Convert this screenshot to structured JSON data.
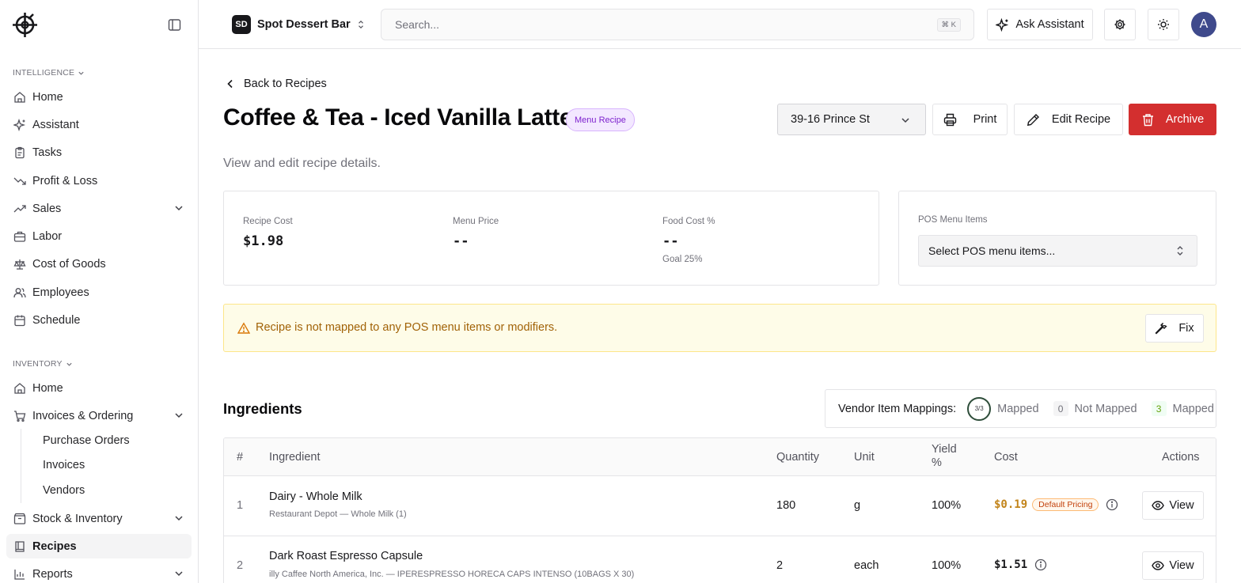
{
  "sidebar": {
    "intelligence_label": "INTELLIGENCE",
    "intelligence_items": [
      {
        "label": "Home",
        "icon": "house-icon"
      },
      {
        "label": "Assistant",
        "icon": "sparkles-icon"
      },
      {
        "label": "Tasks",
        "icon": "clipboard-icon"
      },
      {
        "label": "Profit & Loss",
        "icon": "trending-down-icon"
      },
      {
        "label": "Sales",
        "icon": "trending-up-icon"
      },
      {
        "label": "Labor",
        "icon": "briefcase-icon"
      },
      {
        "label": "Cost of Goods",
        "icon": "scale-icon"
      },
      {
        "label": "Employees",
        "icon": "users-icon"
      },
      {
        "label": "Schedule",
        "icon": "calendar-icon"
      }
    ],
    "inventory_label": "INVENTORY",
    "inventory_items": [
      {
        "label": "Home",
        "icon": "house-icon"
      },
      {
        "label": "Invoices & Ordering",
        "icon": "cart-icon"
      },
      {
        "label": "Stock & Inventory",
        "icon": "box-icon"
      },
      {
        "label": "Recipes",
        "icon": "book-icon",
        "active": true
      },
      {
        "label": "Reports",
        "icon": "chart-icon"
      }
    ],
    "invoice_subitems": [
      "Purchase Orders",
      "Invoices",
      "Vendors"
    ]
  },
  "topbar": {
    "org_initials": "SD",
    "org_name": "Spot Dessert Bar",
    "search_placeholder": "Search...",
    "search_shortcut": "⌘ K",
    "ask_label": "Ask Assistant",
    "avatar_initial": "A"
  },
  "page": {
    "back_label": "Back to Recipes",
    "title": "Coffee & Tea - Iced Vanilla Latte",
    "badge": "Menu Recipe",
    "location": "39-16 Prince St",
    "print_label": "Print",
    "edit_label": "Edit Recipe",
    "archive_label": "Archive",
    "subtitle": "View and edit recipe details."
  },
  "metrics": {
    "recipe_cost_label": "Recipe Cost",
    "recipe_cost": "$1.98",
    "menu_price_label": "Menu Price",
    "menu_price": "--",
    "food_cost_label": "Food Cost %",
    "food_cost": "--",
    "goal": "Goal 25%"
  },
  "pos": {
    "label": "POS Menu Items",
    "placeholder": "Select POS menu items..."
  },
  "alert": {
    "text": "Recipe is not mapped to any POS menu items or modifiers.",
    "fix_label": "Fix"
  },
  "ingredients": {
    "title": "Ingredients",
    "mapping_label": "Vendor Item Mappings:",
    "ring_text": "3/3",
    "mapped_label": "Mapped",
    "not_mapped_count": "0",
    "not_mapped_label": "Not Mapped",
    "mapped_count": "3",
    "mapped_label_2": "Mapped",
    "columns": {
      "num": "#",
      "ingredient": "Ingredient",
      "quantity": "Quantity",
      "unit": "Unit",
      "yield": "Yield %",
      "cost": "Cost",
      "actions": "Actions"
    },
    "rows": [
      {
        "num": "1",
        "name": "Dairy - Whole Milk",
        "vendor": "Restaurant Depot — Whole Milk (1)",
        "quantity": "180",
        "unit": "g",
        "yield": "100%",
        "cost": "$0.19",
        "cost_color": "#c2841a",
        "pricing_badge": "Default Pricing",
        "view_label": "View"
      },
      {
        "num": "2",
        "name": "Dark Roast Espresso Capsule",
        "vendor": "illy Caffee North America, Inc. — IPERESPRESSO HORECA CAPS INTENSO (10BAGS X 30)",
        "quantity": "2",
        "unit": "each",
        "yield": "100%",
        "cost": "$1.51",
        "cost_color": "#18181b",
        "pricing_badge": "",
        "view_label": "View"
      }
    ]
  },
  "colors": {
    "accent_danger": "#d32f2f",
    "badge_purple": "#7e22ce",
    "warning_text": "#a16207"
  }
}
